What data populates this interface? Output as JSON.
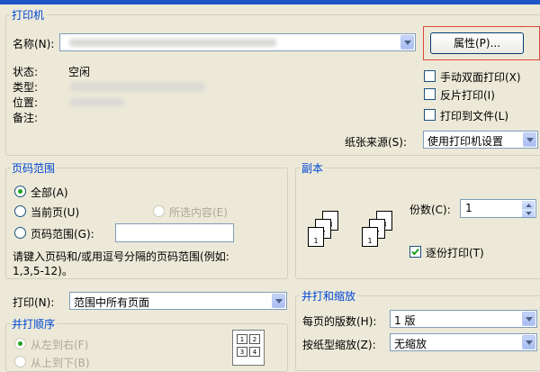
{
  "printer": {
    "group_title": "打印机",
    "name_label": "名称(N):",
    "properties_button": "属性(P)...",
    "status_label": "状态:",
    "status_value": "空闲",
    "type_label": "类型:",
    "location_label": "位置:",
    "comment_label": "备注:",
    "manual_duplex": "手动双面打印(X)",
    "mirror_print": "反片打印(I)",
    "print_to_file": "打印到文件(L)",
    "paper_source_label": "纸张来源(S):",
    "paper_source_value": "使用打印机设置"
  },
  "page_range": {
    "group_title": "页码范围",
    "all": "全部(A)",
    "current_page": "当前页(U)",
    "selection": "所选内容(E)",
    "pages": "页码范围(G):",
    "hint_line1": "请键入页码和/或用逗号分隔的页码范围(例如:",
    "hint_line2": "1,3,5-12)。"
  },
  "copies": {
    "group_title": "副本",
    "count_label": "份数(C):",
    "count_value": "1",
    "collate": "逐份打印(T)"
  },
  "print_what": {
    "label": "打印(N):",
    "value": "范围中所有页面"
  },
  "print_order": {
    "group_title": "并打顺序",
    "left_to_right": "从左到右(F)",
    "top_to_bottom": "从上到下(B)"
  },
  "zoom": {
    "group_title": "并打和缩放",
    "pages_per_sheet_label": "每页的版数(H):",
    "pages_per_sheet_value": "1 版",
    "scale_label": "按纸型缩放(Z):",
    "scale_value": "无缩放"
  },
  "icons": {
    "dropdown": "chevron-down-icon",
    "checkmark": "checkmark-icon",
    "collate_pages": [
      "1",
      "2",
      "3"
    ],
    "layout_preview": [
      "1",
      "2",
      "3",
      "4"
    ]
  },
  "colors": {
    "dialog_bg": "#ece9d8",
    "group_title": "#0046d5",
    "highlight_box": "#e0453c",
    "radio_selected": "#21a121"
  }
}
